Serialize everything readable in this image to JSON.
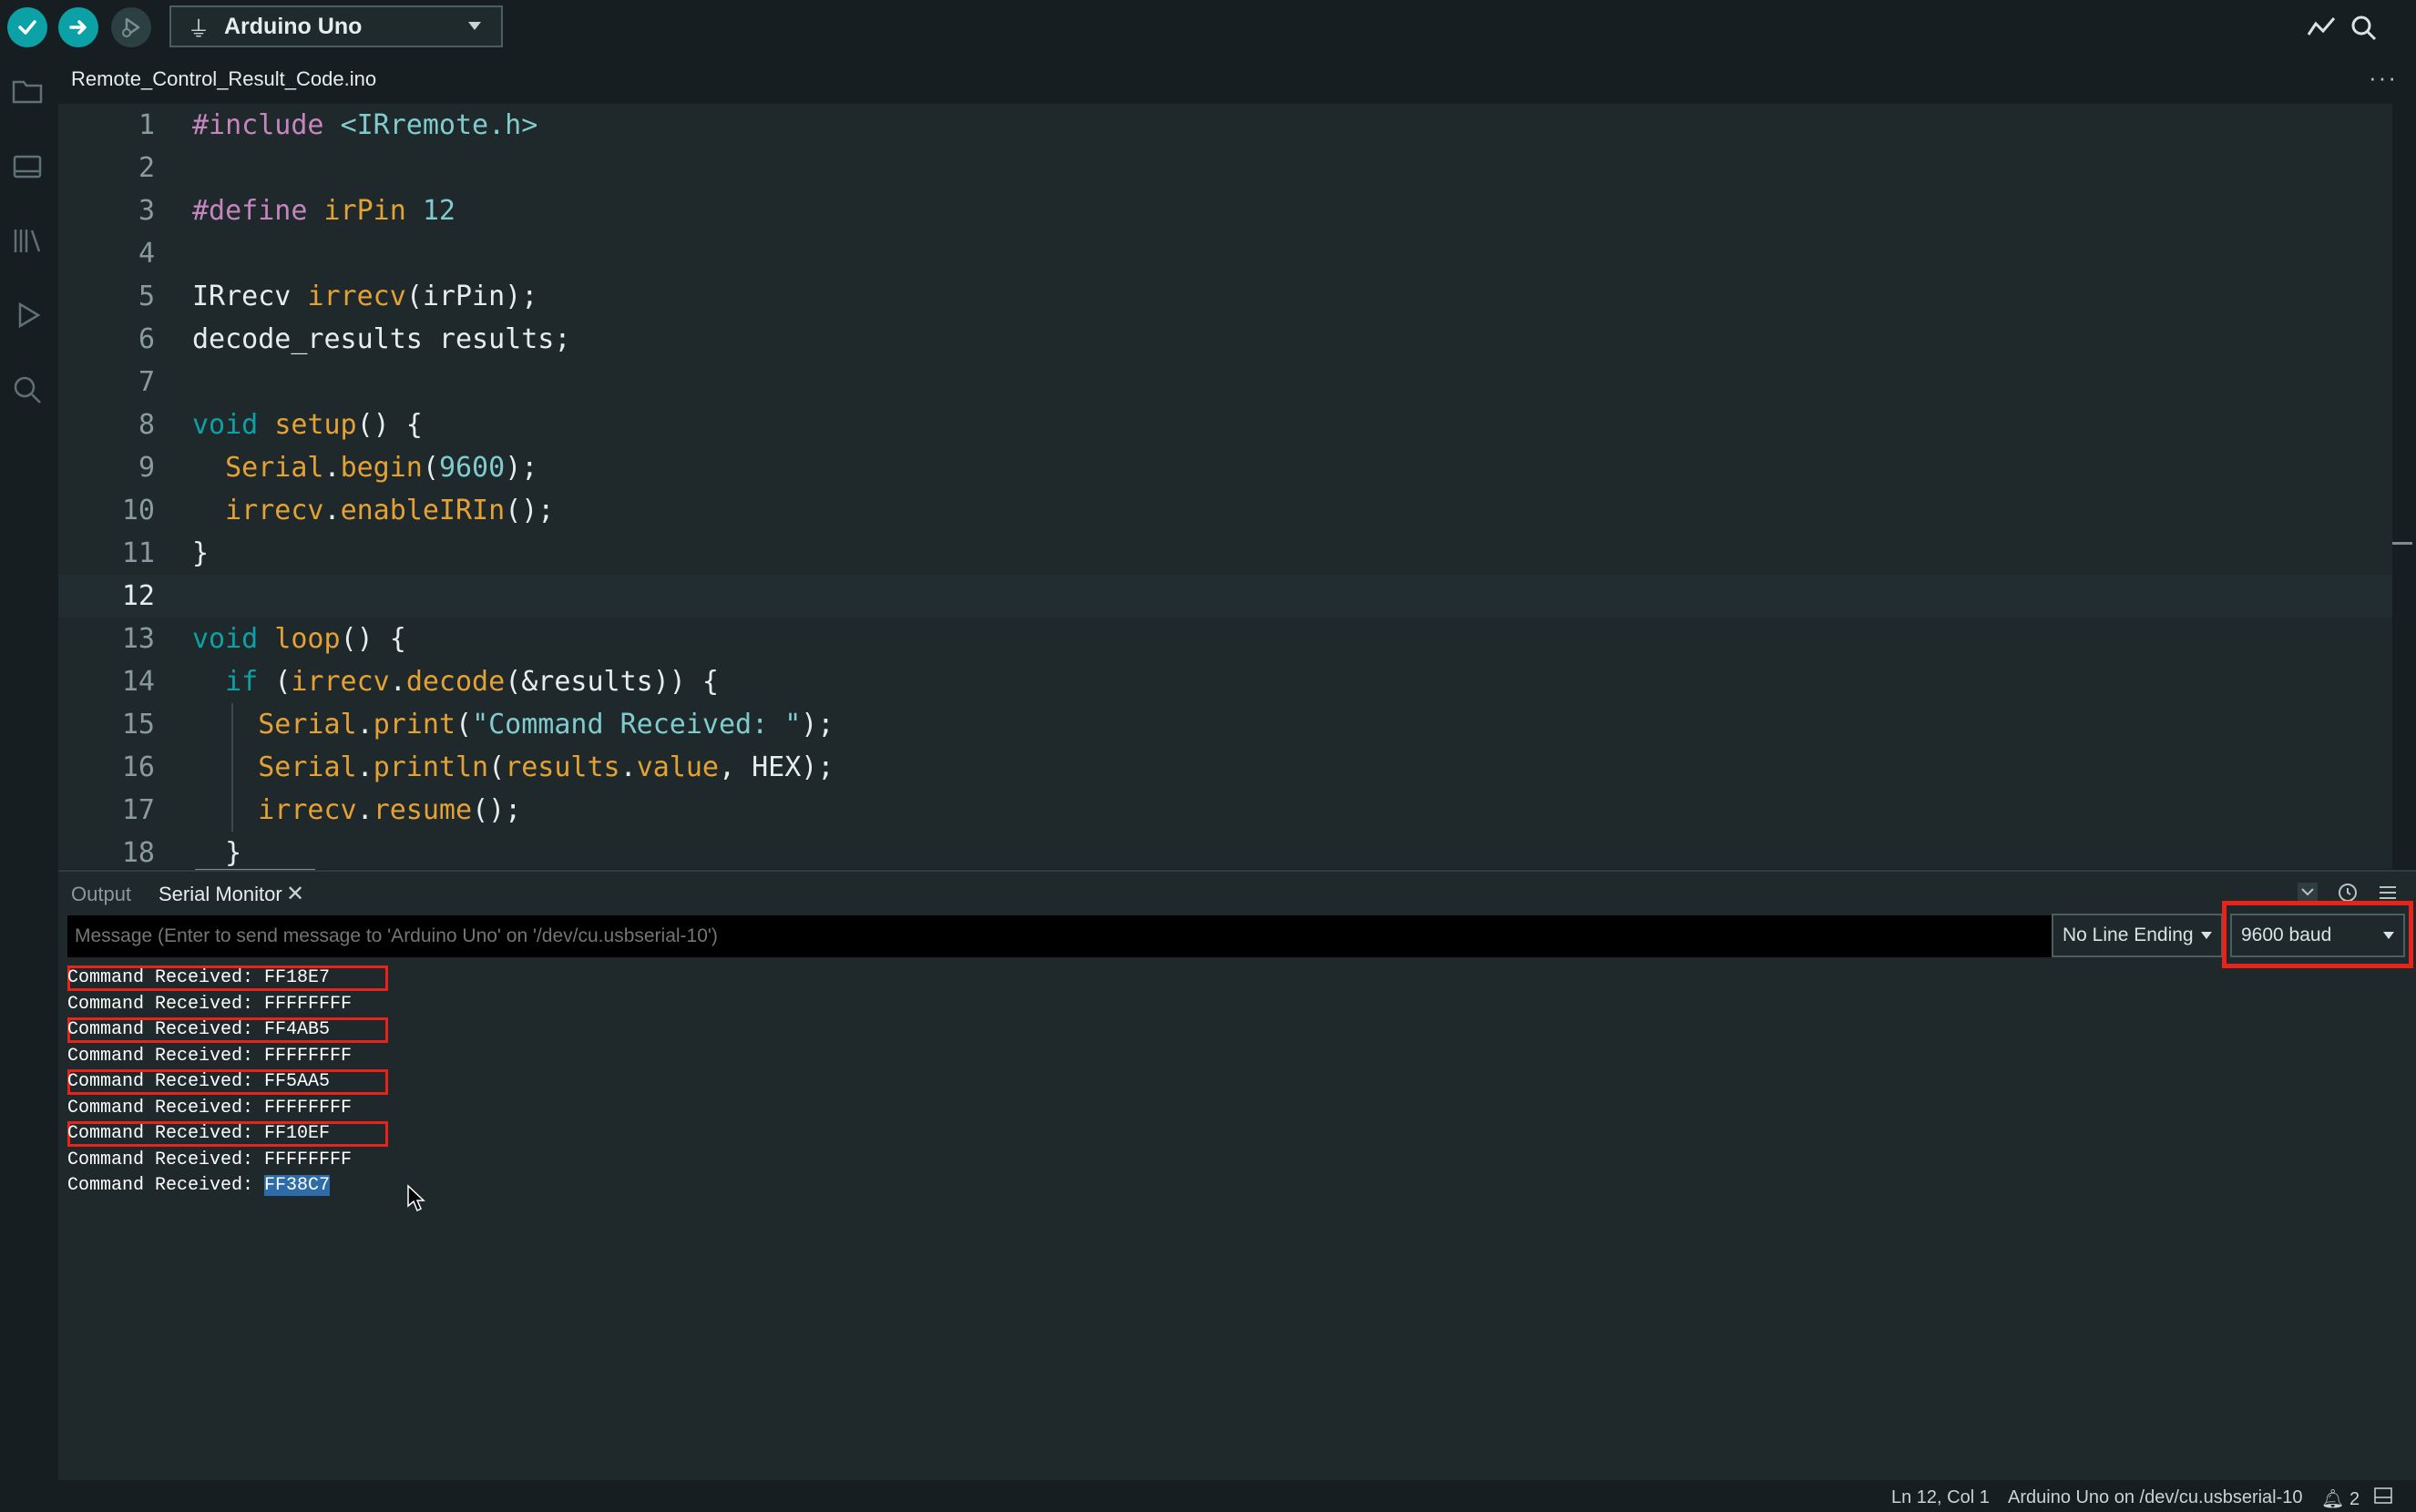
{
  "toolbar": {
    "board": "Arduino Uno"
  },
  "editor": {
    "file_tab": "Remote_Control_Result_Code.ino",
    "more": "···",
    "current_line": 12,
    "lines": [
      {
        "n": "1",
        "segs": [
          [
            "kw-pre",
            "#include "
          ],
          [
            "num",
            "<IRremote.h>"
          ]
        ]
      },
      {
        "n": "2",
        "segs": []
      },
      {
        "n": "3",
        "segs": [
          [
            "kw-pre",
            "#define "
          ],
          [
            "fn",
            "irPin "
          ],
          [
            "num",
            "12"
          ]
        ]
      },
      {
        "n": "4",
        "segs": []
      },
      {
        "n": "5",
        "segs": [
          [
            "",
            "IRrecv "
          ],
          [
            "fn",
            "irrecv"
          ],
          [
            "",
            "(irPin);"
          ]
        ]
      },
      {
        "n": "6",
        "segs": [
          [
            "",
            "decode_results results;"
          ]
        ]
      },
      {
        "n": "7",
        "segs": []
      },
      {
        "n": "8",
        "segs": [
          [
            "kw-type",
            "void "
          ],
          [
            "fn",
            "setup"
          ],
          [
            "",
            "() {"
          ]
        ]
      },
      {
        "n": "9",
        "segs": [
          [
            "",
            "  "
          ],
          [
            "fn",
            "Serial"
          ],
          [
            "",
            "."
          ],
          [
            "fn",
            "begin"
          ],
          [
            "",
            "("
          ],
          [
            "num",
            "9600"
          ],
          [
            "",
            ");"
          ]
        ]
      },
      {
        "n": "10",
        "segs": [
          [
            "",
            "  "
          ],
          [
            "fn",
            "irrecv"
          ],
          [
            "",
            "."
          ],
          [
            "fn",
            "enableIRIn"
          ],
          [
            "",
            "();"
          ]
        ]
      },
      {
        "n": "11",
        "segs": [
          [
            "",
            "}"
          ]
        ]
      },
      {
        "n": "12",
        "segs": []
      },
      {
        "n": "13",
        "segs": [
          [
            "kw-type",
            "void "
          ],
          [
            "fn",
            "loop"
          ],
          [
            "",
            "() {"
          ]
        ]
      },
      {
        "n": "14",
        "segs": [
          [
            "",
            "  "
          ],
          [
            "kw-type",
            "if "
          ],
          [
            "",
            "("
          ],
          [
            "fn",
            "irrecv"
          ],
          [
            "",
            "."
          ],
          [
            "fn",
            "decode"
          ],
          [
            "",
            "(&results)) {"
          ]
        ]
      },
      {
        "n": "15",
        "segs": [
          [
            "",
            "    "
          ],
          [
            "fn",
            "Serial"
          ],
          [
            "",
            "."
          ],
          [
            "fn",
            "print"
          ],
          [
            "",
            "("
          ],
          [
            "str",
            "\"Command Received: \""
          ],
          [
            "",
            ");"
          ]
        ]
      },
      {
        "n": "16",
        "segs": [
          [
            "",
            "    "
          ],
          [
            "fn",
            "Serial"
          ],
          [
            "",
            "."
          ],
          [
            "fn",
            "println"
          ],
          [
            "",
            "("
          ],
          [
            "fn",
            "results"
          ],
          [
            "",
            "."
          ],
          [
            "fn",
            "value"
          ],
          [
            "",
            ", HEX);"
          ]
        ]
      },
      {
        "n": "17",
        "segs": [
          [
            "",
            "    "
          ],
          [
            "fn",
            "irrecv"
          ],
          [
            "",
            "."
          ],
          [
            "fn",
            "resume"
          ],
          [
            "",
            "();"
          ]
        ]
      },
      {
        "n": "18",
        "segs": [
          [
            "",
            "  }"
          ]
        ]
      }
    ]
  },
  "panel": {
    "tab_output": "Output",
    "tab_serial": "Serial Monitor",
    "close": "✕",
    "message_placeholder": "Message (Enter to send message to 'Arduino Uno' on '/dev/cu.usbserial-10')",
    "line_ending": "No Line Ending",
    "baud": "9600 baud",
    "output": [
      {
        "prefix": "Command Received: ",
        "value": "FF18E7",
        "boxed": true
      },
      {
        "prefix": "Command Received: ",
        "value": "FFFFFFFF",
        "boxed": false
      },
      {
        "prefix": "Command Received: ",
        "value": "FF4AB5",
        "boxed": true
      },
      {
        "prefix": "Command Received: ",
        "value": "FFFFFFFF",
        "boxed": false
      },
      {
        "prefix": "Command Received: ",
        "value": "FF5AA5",
        "boxed": true
      },
      {
        "prefix": "Command Received: ",
        "value": "FFFFFFFF",
        "boxed": false
      },
      {
        "prefix": "Command Received: ",
        "value": "FF10EF",
        "boxed": true
      },
      {
        "prefix": "Command Received: ",
        "value": "FFFFFFFF",
        "boxed": false
      },
      {
        "prefix": "Command Received: ",
        "value": "FF38C7",
        "boxed": false,
        "selected": true
      }
    ]
  },
  "status": {
    "position": "Ln 12, Col 1",
    "board": "Arduino Uno on /dev/cu.usbserial-10",
    "notifications": "2"
  },
  "colors": {
    "accent": "#0ca1a6",
    "highlight_box": "#e8241a",
    "selection": "#2d6ca8"
  }
}
